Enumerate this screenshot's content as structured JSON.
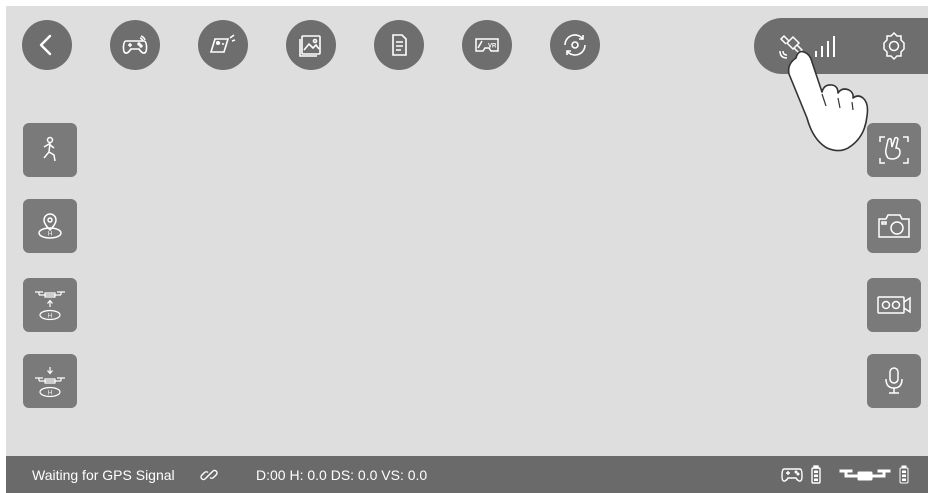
{
  "colors": {
    "button": "#6e6e6e",
    "side_button": "#7a7a7a",
    "background": "#dedede",
    "status_bar": "#6a6a6a",
    "icon": "#ffffff"
  },
  "toolbar": {
    "items": [
      {
        "name": "back",
        "icon": "chevron-left-icon"
      },
      {
        "name": "controller",
        "icon": "gamepad-icon"
      },
      {
        "name": "trajectory",
        "icon": "trajectory-icon"
      },
      {
        "name": "gallery",
        "icon": "image-icon"
      },
      {
        "name": "files",
        "icon": "document-icon"
      },
      {
        "name": "vr",
        "icon": "vr-icon",
        "label": "VR"
      },
      {
        "name": "rotate",
        "icon": "rotate-icon"
      }
    ]
  },
  "top_right": {
    "gps_icon": "satellite-icon",
    "signal_icon": "signal-bars-icon",
    "settings_icon": "gear-icon"
  },
  "left_panel": [
    {
      "name": "follow-mode",
      "icon": "running-person-icon"
    },
    {
      "name": "return-home",
      "icon": "home-point-icon"
    },
    {
      "name": "takeoff",
      "icon": "drone-takeoff-icon"
    },
    {
      "name": "landing",
      "icon": "drone-landing-icon"
    }
  ],
  "right_panel": [
    {
      "name": "gesture",
      "icon": "gesture-icon"
    },
    {
      "name": "photo",
      "icon": "camera-icon"
    },
    {
      "name": "video",
      "icon": "video-icon"
    },
    {
      "name": "voice",
      "icon": "microphone-icon"
    }
  ],
  "status": {
    "gps_message": "Waiting for GPS Signal",
    "link_icon": "link-icon",
    "telemetry": "D:00 H: 0.0 DS: 0.0 VS: 0.0",
    "controller_battery_icon": "controller-battery-icon",
    "drone_battery_icon": "drone-battery-icon"
  }
}
